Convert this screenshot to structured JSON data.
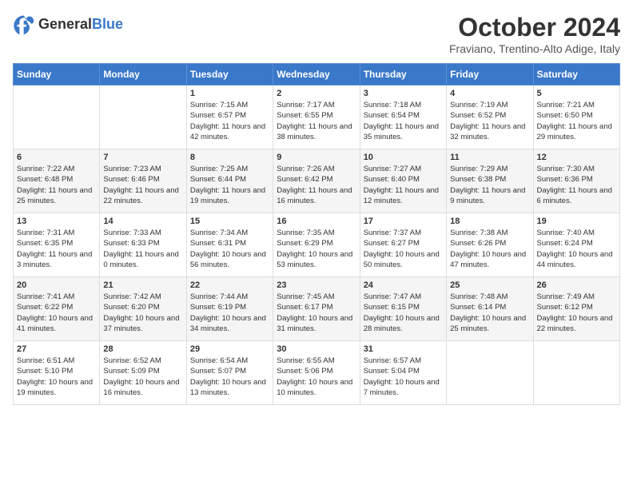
{
  "header": {
    "logo_general": "General",
    "logo_blue": "Blue",
    "month_title": "October 2024",
    "location": "Fraviano, Trentino-Alto Adige, Italy"
  },
  "days_of_week": [
    "Sunday",
    "Monday",
    "Tuesday",
    "Wednesday",
    "Thursday",
    "Friday",
    "Saturday"
  ],
  "weeks": [
    [
      {
        "day": "",
        "text": ""
      },
      {
        "day": "",
        "text": ""
      },
      {
        "day": "1",
        "text": "Sunrise: 7:15 AM\nSunset: 6:57 PM\nDaylight: 11 hours and 42 minutes."
      },
      {
        "day": "2",
        "text": "Sunrise: 7:17 AM\nSunset: 6:55 PM\nDaylight: 11 hours and 38 minutes."
      },
      {
        "day": "3",
        "text": "Sunrise: 7:18 AM\nSunset: 6:54 PM\nDaylight: 11 hours and 35 minutes."
      },
      {
        "day": "4",
        "text": "Sunrise: 7:19 AM\nSunset: 6:52 PM\nDaylight: 11 hours and 32 minutes."
      },
      {
        "day": "5",
        "text": "Sunrise: 7:21 AM\nSunset: 6:50 PM\nDaylight: 11 hours and 29 minutes."
      }
    ],
    [
      {
        "day": "6",
        "text": "Sunrise: 7:22 AM\nSunset: 6:48 PM\nDaylight: 11 hours and 25 minutes."
      },
      {
        "day": "7",
        "text": "Sunrise: 7:23 AM\nSunset: 6:46 PM\nDaylight: 11 hours and 22 minutes."
      },
      {
        "day": "8",
        "text": "Sunrise: 7:25 AM\nSunset: 6:44 PM\nDaylight: 11 hours and 19 minutes."
      },
      {
        "day": "9",
        "text": "Sunrise: 7:26 AM\nSunset: 6:42 PM\nDaylight: 11 hours and 16 minutes."
      },
      {
        "day": "10",
        "text": "Sunrise: 7:27 AM\nSunset: 6:40 PM\nDaylight: 11 hours and 12 minutes."
      },
      {
        "day": "11",
        "text": "Sunrise: 7:29 AM\nSunset: 6:38 PM\nDaylight: 11 hours and 9 minutes."
      },
      {
        "day": "12",
        "text": "Sunrise: 7:30 AM\nSunset: 6:36 PM\nDaylight: 11 hours and 6 minutes."
      }
    ],
    [
      {
        "day": "13",
        "text": "Sunrise: 7:31 AM\nSunset: 6:35 PM\nDaylight: 11 hours and 3 minutes."
      },
      {
        "day": "14",
        "text": "Sunrise: 7:33 AM\nSunset: 6:33 PM\nDaylight: 11 hours and 0 minutes."
      },
      {
        "day": "15",
        "text": "Sunrise: 7:34 AM\nSunset: 6:31 PM\nDaylight: 10 hours and 56 minutes."
      },
      {
        "day": "16",
        "text": "Sunrise: 7:35 AM\nSunset: 6:29 PM\nDaylight: 10 hours and 53 minutes."
      },
      {
        "day": "17",
        "text": "Sunrise: 7:37 AM\nSunset: 6:27 PM\nDaylight: 10 hours and 50 minutes."
      },
      {
        "day": "18",
        "text": "Sunrise: 7:38 AM\nSunset: 6:26 PM\nDaylight: 10 hours and 47 minutes."
      },
      {
        "day": "19",
        "text": "Sunrise: 7:40 AM\nSunset: 6:24 PM\nDaylight: 10 hours and 44 minutes."
      }
    ],
    [
      {
        "day": "20",
        "text": "Sunrise: 7:41 AM\nSunset: 6:22 PM\nDaylight: 10 hours and 41 minutes."
      },
      {
        "day": "21",
        "text": "Sunrise: 7:42 AM\nSunset: 6:20 PM\nDaylight: 10 hours and 37 minutes."
      },
      {
        "day": "22",
        "text": "Sunrise: 7:44 AM\nSunset: 6:19 PM\nDaylight: 10 hours and 34 minutes."
      },
      {
        "day": "23",
        "text": "Sunrise: 7:45 AM\nSunset: 6:17 PM\nDaylight: 10 hours and 31 minutes."
      },
      {
        "day": "24",
        "text": "Sunrise: 7:47 AM\nSunset: 6:15 PM\nDaylight: 10 hours and 28 minutes."
      },
      {
        "day": "25",
        "text": "Sunrise: 7:48 AM\nSunset: 6:14 PM\nDaylight: 10 hours and 25 minutes."
      },
      {
        "day": "26",
        "text": "Sunrise: 7:49 AM\nSunset: 6:12 PM\nDaylight: 10 hours and 22 minutes."
      }
    ],
    [
      {
        "day": "27",
        "text": "Sunrise: 6:51 AM\nSunset: 5:10 PM\nDaylight: 10 hours and 19 minutes."
      },
      {
        "day": "28",
        "text": "Sunrise: 6:52 AM\nSunset: 5:09 PM\nDaylight: 10 hours and 16 minutes."
      },
      {
        "day": "29",
        "text": "Sunrise: 6:54 AM\nSunset: 5:07 PM\nDaylight: 10 hours and 13 minutes."
      },
      {
        "day": "30",
        "text": "Sunrise: 6:55 AM\nSunset: 5:06 PM\nDaylight: 10 hours and 10 minutes."
      },
      {
        "day": "31",
        "text": "Sunrise: 6:57 AM\nSunset: 5:04 PM\nDaylight: 10 hours and 7 minutes."
      },
      {
        "day": "",
        "text": ""
      },
      {
        "day": "",
        "text": ""
      }
    ]
  ]
}
